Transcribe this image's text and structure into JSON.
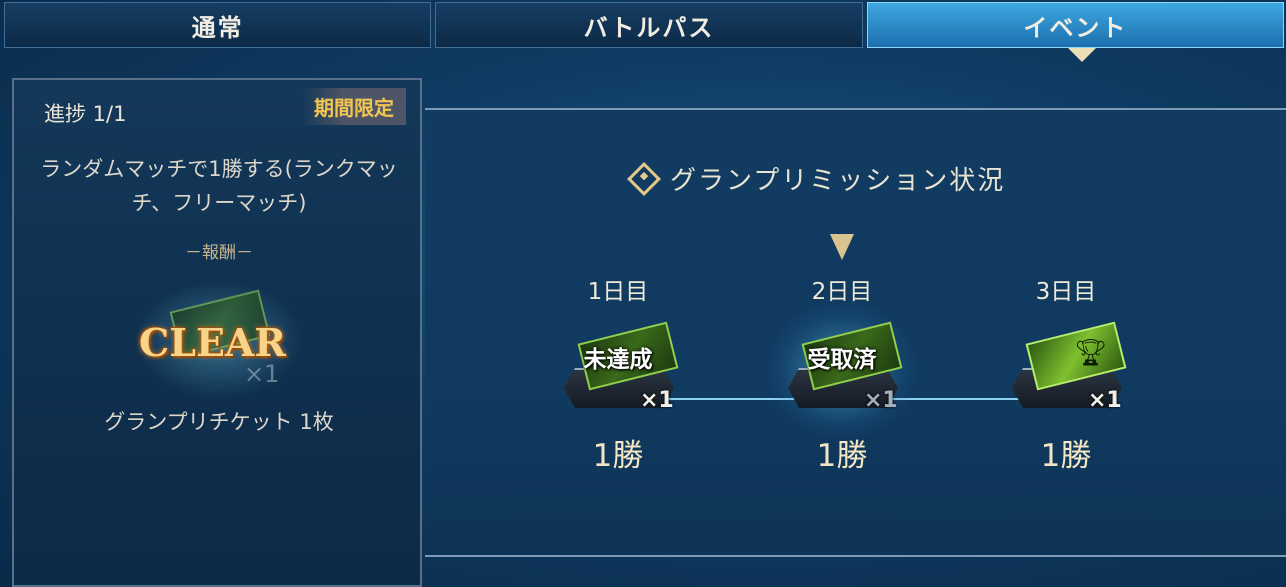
{
  "tabs": [
    {
      "label": "通常",
      "active": false
    },
    {
      "label": "バトルパス",
      "active": false
    },
    {
      "label": "イベント",
      "active": true
    }
  ],
  "mission_card": {
    "progress": "進捗 1/1",
    "limited_badge": "期間限定",
    "description": "ランダムマッチで1勝する(ランクマッチ、フリーマッチ)",
    "reward_label": "－報酬－",
    "stamp": "CLEAR",
    "reward_qty": "×1",
    "reward_name": "グランプリチケット 1枚"
  },
  "grand_prix": {
    "title": "グランプリミッション状況",
    "current_day_index": 1,
    "days": [
      {
        "label": "1日目",
        "status": "未達成",
        "count": "×1",
        "wins": "1勝"
      },
      {
        "label": "2日目",
        "status": "受取済",
        "count": "×1",
        "wins": "1勝"
      },
      {
        "label": "3日目",
        "status": "",
        "count": "×1",
        "wins": "1勝",
        "icon": "trophy-icon"
      }
    ]
  },
  "colors": {
    "accent_gold": "#f2c650",
    "active_tab": "#3fa8e0",
    "ticket_green": "#7fc02e"
  }
}
